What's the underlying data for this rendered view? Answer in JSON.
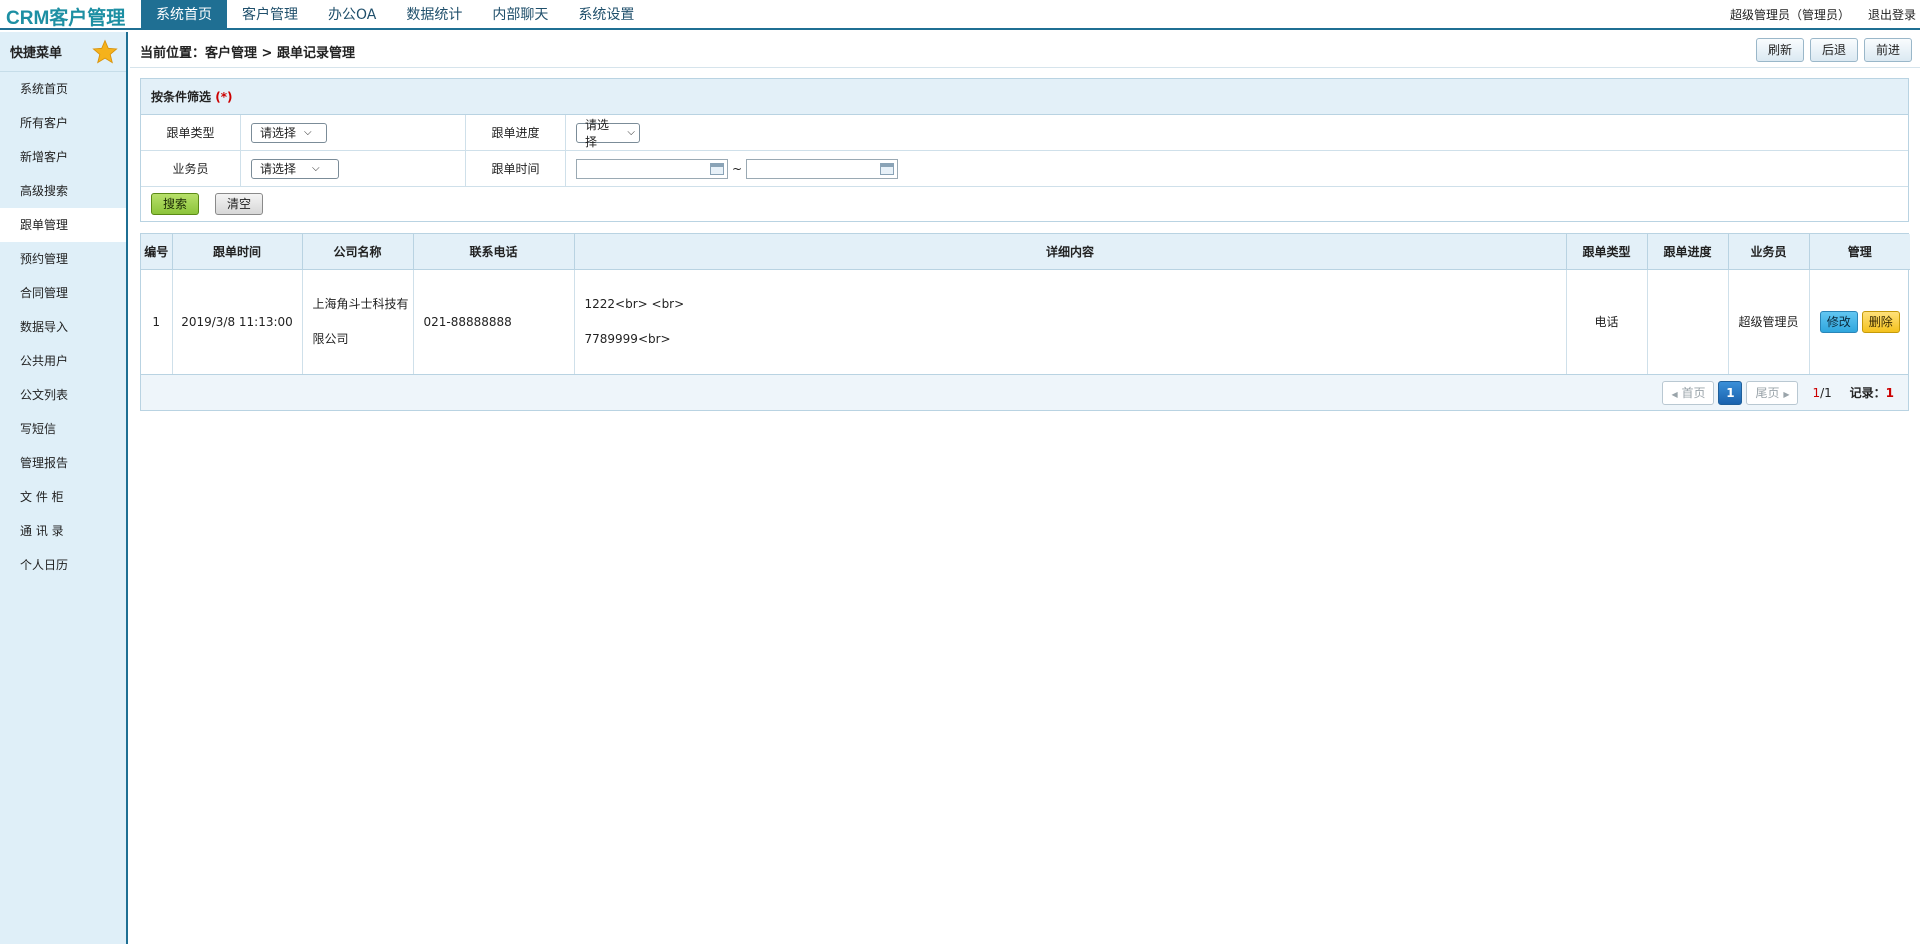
{
  "app": {
    "logo": "CRM客户管理"
  },
  "nav": [
    {
      "label": "系统首页",
      "active": true
    },
    {
      "label": "客户管理",
      "active": false
    },
    {
      "label": "办公OA",
      "active": false
    },
    {
      "label": "数据统计",
      "active": false
    },
    {
      "label": "内部聊天",
      "active": false
    },
    {
      "label": "系统设置",
      "active": false
    }
  ],
  "user": {
    "name": "超级管理员（管理员）",
    "logout": "退出登录"
  },
  "sidebar": {
    "title": "快捷菜单",
    "items": [
      {
        "label": "系统首页"
      },
      {
        "label": "所有客户"
      },
      {
        "label": "新增客户"
      },
      {
        "label": "高级搜索"
      },
      {
        "label": "跟单管理",
        "active": true
      },
      {
        "label": "预约管理"
      },
      {
        "label": "合同管理"
      },
      {
        "label": "数据导入"
      },
      {
        "label": "公共用户"
      },
      {
        "label": "公文列表"
      },
      {
        "label": "写短信"
      },
      {
        "label": "管理报告"
      },
      {
        "label": "文 件 柜"
      },
      {
        "label": "通 讯 录"
      },
      {
        "label": "个人日历"
      }
    ]
  },
  "breadcrumb": {
    "text": "当前位置：客户管理 > 跟单记录管理"
  },
  "toolbar": {
    "refresh": "刷新",
    "back": "后退",
    "forward": "前进"
  },
  "filter": {
    "title": "按条件筛选",
    "required_mark": "(*)",
    "type_label": "跟单类型",
    "type_value": "请选择",
    "progress_label": "跟单进度",
    "progress_value": "请选择",
    "salesman_label": "业务员",
    "salesman_value": "请选择",
    "time_label": "跟单时间",
    "time_from": "",
    "time_to": "",
    "separator": "~",
    "search": "搜索",
    "clear": "清空"
  },
  "table": {
    "headers": [
      "编号",
      "跟单时间",
      "公司名称",
      "联系电话",
      "详细内容",
      "跟单类型",
      "跟单进度",
      "业务员",
      "管理"
    ],
    "rows": [
      {
        "id": "1",
        "time": "2019/3/8 11:13:00",
        "company_line1": "上海角斗士科技有",
        "company_line2": "限公司",
        "phone": "021-88888888",
        "detail_line1": "1222<br> <br>",
        "detail_line2": "7789999<br>",
        "type": "电话",
        "progress": "",
        "salesman": "超级管理员",
        "edit": "修改",
        "delete": "删除"
      }
    ]
  },
  "pager": {
    "first": "首页",
    "current": "1",
    "last": "尾页",
    "page_current": "1",
    "page_total": "/1",
    "records_label": "记录：",
    "records": "1"
  },
  "colors": {
    "accent": "#1f6f93",
    "sidebar_bg": "#dfeff8",
    "header_bg": "#e3f0f8",
    "logo": "#1d8fa3"
  }
}
